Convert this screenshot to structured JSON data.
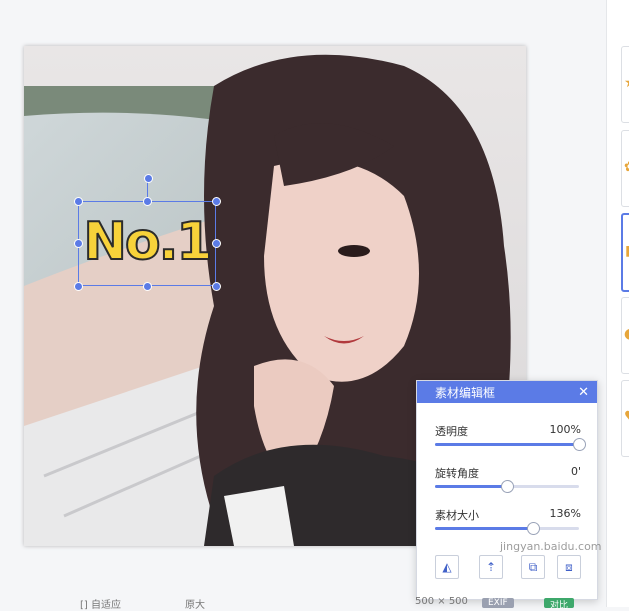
{
  "panel": {
    "title": "素材编辑框",
    "close_icon": "close-icon",
    "sliders": [
      {
        "label": "透明度",
        "value_text": "100%",
        "fraction": 1.0
      },
      {
        "label": "旋转角度",
        "value_text": "0'",
        "fraction": 0.5
      },
      {
        "label": "素材大小",
        "value_text": "136%",
        "fraction": 0.68
      }
    ],
    "tools": [
      {
        "icon": "flip-horizontal-icon"
      },
      {
        "icon": "layer-up-icon"
      },
      {
        "icon": "layer-down-icon"
      },
      {
        "icon": "copy-icon"
      }
    ]
  },
  "sticker": {
    "text": "No.1"
  },
  "watermark": "jingyan.baidu.com",
  "bottom_bar": {
    "items": [
      "[] 自适应",
      "原大"
    ],
    "size_text": "500 × 500",
    "chip1": "EXIF",
    "chip2": "对比"
  },
  "colors": {
    "accent": "#5b7be6",
    "sticker_yellow": "#f7d23a"
  }
}
